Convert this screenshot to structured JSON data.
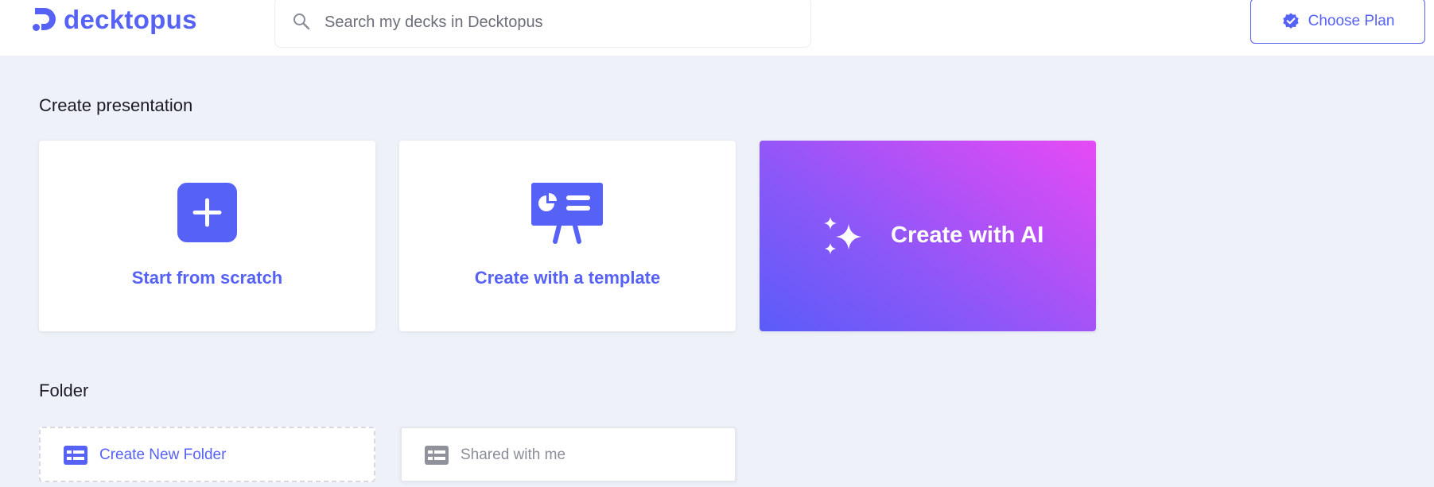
{
  "header": {
    "logo_text": "decktopus",
    "search_placeholder": "Search my decks in Decktopus",
    "choose_plan_label": "Choose Plan"
  },
  "create_section": {
    "title": "Create presentation",
    "cards": [
      {
        "label": "Start from scratch",
        "icon": "plus-icon"
      },
      {
        "label": "Create with a template",
        "icon": "presentation-board-icon"
      },
      {
        "label": "Create with AI",
        "icon": "sparkle-icon"
      }
    ]
  },
  "folder_section": {
    "title": "Folder",
    "items": [
      {
        "label": "Create New Folder",
        "icon": "folder-list-icon"
      },
      {
        "label": "Shared with me",
        "icon": "folder-list-icon"
      }
    ]
  },
  "colors": {
    "accent": "#5661f6",
    "background": "#eef1f8",
    "ai_gradient_start": "#5a5cf9",
    "ai_gradient_end": "#e64af5"
  }
}
